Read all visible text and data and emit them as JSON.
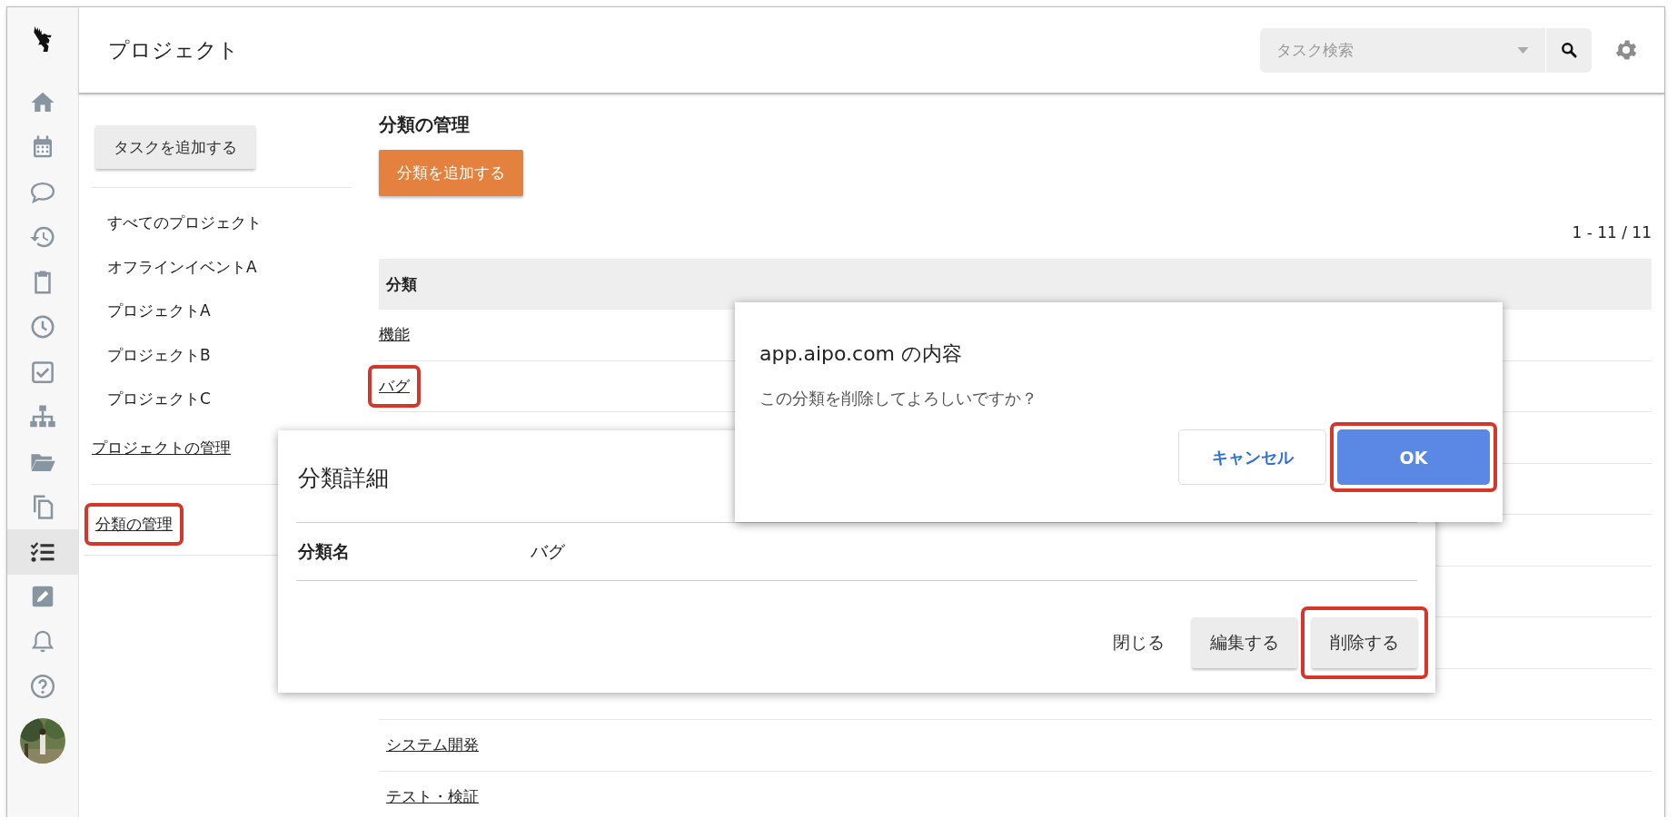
{
  "app": {
    "title": "プロジェクト"
  },
  "search": {
    "placeholder": "タスク検索"
  },
  "rail": {
    "items": [
      {
        "selected": false
      },
      {
        "selected": false
      },
      {
        "selected": false
      },
      {
        "selected": false
      },
      {
        "selected": false
      },
      {
        "selected": false
      },
      {
        "selected": false
      },
      {
        "selected": false
      },
      {
        "selected": false
      },
      {
        "selected": false
      },
      {
        "selected": true
      },
      {
        "selected": false
      },
      {
        "selected": false
      },
      {
        "selected": false
      }
    ]
  },
  "nav": {
    "add_button": "タスクを追加する",
    "projects": [
      "すべてのプロジェクト",
      "オフラインイベントA",
      "プロジェクトA",
      "プロジェクトB",
      "プロジェクトC"
    ],
    "manage_projects": "プロジェクトの管理",
    "manage_categories": {
      "label": "分類の管理",
      "highlighted": true
    }
  },
  "main": {
    "title": "分類の管理",
    "add_button": "分類を追加する",
    "pagination": "1 - 11 / 11",
    "table": {
      "columns": [
        "分類"
      ],
      "rows_top": [
        {
          "name": "機能",
          "highlighted": false
        },
        {
          "name": "バグ",
          "highlighted": true
        }
      ],
      "rows_bottom": [
        {
          "name": "システム開発"
        },
        {
          "name": "テスト・検証"
        }
      ]
    }
  },
  "detail_dialog": {
    "title": "分類詳細",
    "field_label": "分類名",
    "field_value": "バグ",
    "buttons": [
      {
        "label": "閉じる",
        "kind": "text",
        "highlighted": false
      },
      {
        "label": "編集する",
        "kind": "raised",
        "highlighted": false
      },
      {
        "label": "削除する",
        "kind": "raised",
        "highlighted": true
      }
    ]
  },
  "confirm_dialog": {
    "title": "app.aipo.com の内容",
    "message": "この分類を削除してよろしいですか？",
    "buttons": [
      {
        "label": "キャンセル",
        "kind": "outline",
        "highlighted": false
      },
      {
        "label": "OK",
        "kind": "primary",
        "highlighted": true
      }
    ]
  }
}
